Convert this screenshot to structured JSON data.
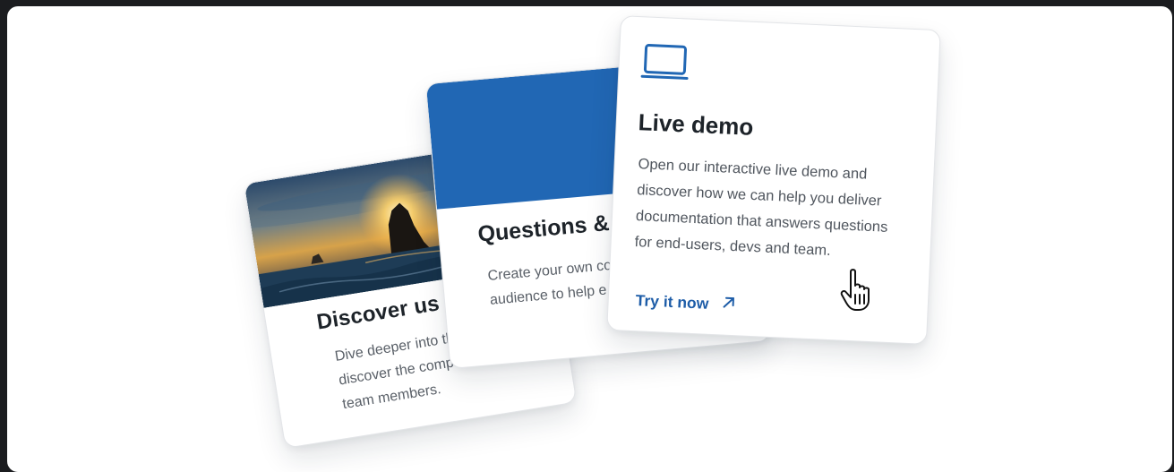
{
  "cards": [
    {
      "title": "Discover us",
      "description": "Dive deeper into the page and discover the company's history, m team members."
    },
    {
      "title": "Questions &",
      "description": "Create your own co forum like section a audience to help e"
    },
    {
      "title": "Live demo",
      "description": "Open our interactive live demo and discover how we can help you deliver documentation that answers questions for end-users, devs and team.",
      "cta_label": "Try it now"
    }
  ],
  "icons": {
    "laptop": "laptop-icon",
    "arrow": "arrow-up-right-icon",
    "cursor": "hand-pointer-icon"
  },
  "colors": {
    "accent_blue": "#2167b4",
    "link_blue": "#1e5da8",
    "title": "#1d2329",
    "body_text": "#5a6068"
  }
}
